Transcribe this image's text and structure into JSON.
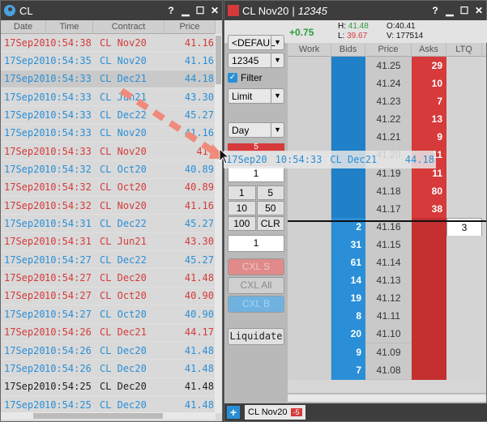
{
  "ts": {
    "title": "CL",
    "headers": [
      "Date",
      "Time",
      "Contract",
      "Price"
    ],
    "rows": [
      {
        "date": "17Sep20",
        "time": "10:54:38",
        "contract": "CL Nov20",
        "price": "41.16",
        "color": "red"
      },
      {
        "date": "17Sep20",
        "time": "10:54:35",
        "contract": "CL Nov20",
        "price": "41.16",
        "color": "blue"
      },
      {
        "date": "17Sep20",
        "time": "10:54:33",
        "contract": "CL Dec21",
        "price": "44.18",
        "color": "blue"
      },
      {
        "date": "17Sep20",
        "time": "10:54:33",
        "contract": "CL Jun21",
        "price": "43.30",
        "color": "blue"
      },
      {
        "date": "17Sep20",
        "time": "10:54:33",
        "contract": "CL Dec22",
        "price": "45.27",
        "color": "blue"
      },
      {
        "date": "17Sep20",
        "time": "10:54:33",
        "contract": "CL Nov20",
        "price": "41.16",
        "color": "blue"
      },
      {
        "date": "17Sep20",
        "time": "10:54:33",
        "contract": "CL Nov20",
        "price": "41.",
        "color": "red"
      },
      {
        "date": "17Sep20",
        "time": "10:54:32",
        "contract": "CL Oct20",
        "price": "40.89",
        "color": "blue"
      },
      {
        "date": "17Sep20",
        "time": "10:54:32",
        "contract": "CL Oct20",
        "price": "40.89",
        "color": "red"
      },
      {
        "date": "17Sep20",
        "time": "10:54:32",
        "contract": "CL Nov20",
        "price": "41.16",
        "color": "red"
      },
      {
        "date": "17Sep20",
        "time": "10:54:31",
        "contract": "CL Dec22",
        "price": "45.27",
        "color": "blue"
      },
      {
        "date": "17Sep20",
        "time": "10:54:31",
        "contract": "CL Jun21",
        "price": "43.30",
        "color": "red"
      },
      {
        "date": "17Sep20",
        "time": "10:54:27",
        "contract": "CL Dec22",
        "price": "45.27",
        "color": "blue"
      },
      {
        "date": "17Sep20",
        "time": "10:54:27",
        "contract": "CL Dec20",
        "price": "41.48",
        "color": "red"
      },
      {
        "date": "17Sep20",
        "time": "10:54:27",
        "contract": "CL Oct20",
        "price": "40.90",
        "color": "red"
      },
      {
        "date": "17Sep20",
        "time": "10:54:27",
        "contract": "CL Oct20",
        "price": "40.90",
        "color": "blue"
      },
      {
        "date": "17Sep20",
        "time": "10:54:26",
        "contract": "CL Dec21",
        "price": "44.17",
        "color": "red"
      },
      {
        "date": "17Sep20",
        "time": "10:54:26",
        "contract": "CL Dec20",
        "price": "41.48",
        "color": "blue"
      },
      {
        "date": "17Sep20",
        "time": "10:54:26",
        "contract": "CL Dec20",
        "price": "41.48",
        "color": "blue"
      },
      {
        "date": "17Sep20",
        "time": "10:54:25",
        "contract": "CL Dec20",
        "price": "41.48",
        "color": "black"
      },
      {
        "date": "17Sep20",
        "time": "10:54:25",
        "contract": "CL Dec20",
        "price": "41.48",
        "color": "blue"
      }
    ]
  },
  "ladder": {
    "title": "CL Nov20",
    "account": "12345",
    "change": "+0.75",
    "high_label": "H:",
    "high": "41.48",
    "low_label": "L:",
    "low": "39.67",
    "open_label": "O:",
    "open": "40.41",
    "vol_label": "V:",
    "vol": "177514",
    "account_select": "<DEFAUL",
    "account_select2": "12345",
    "filter_label": "Filter",
    "order_type": "Limit",
    "tif": "Day",
    "sell_badge": "5",
    "qty_top": "1",
    "numpad": [
      "1",
      "5",
      "10",
      "50",
      "100",
      "CLR"
    ],
    "qty_bottom": "1",
    "cxl_s": "CXL S",
    "cxl_all": "CXL All",
    "cxl_b": "CXL B",
    "liquidate": "Liquidate",
    "headers": [
      "Work",
      "Bids",
      "Price",
      "Asks",
      "LTQ"
    ],
    "rows": [
      {
        "bid": "",
        "price": "41.25",
        "ask": "29",
        "ltq": ""
      },
      {
        "bid": "",
        "price": "41.24",
        "ask": "10",
        "ltq": ""
      },
      {
        "bid": "",
        "price": "41.23",
        "ask": "7",
        "ltq": ""
      },
      {
        "bid": "",
        "price": "41.22",
        "ask": "13",
        "ltq": ""
      },
      {
        "bid": "",
        "price": "41.21",
        "ask": "9",
        "ltq": ""
      },
      {
        "bid": "",
        "price": "41.20",
        "ask": "11",
        "ltq": ""
      },
      {
        "bid": "",
        "price": "41.19",
        "ask": "11",
        "ltq": ""
      },
      {
        "bid": "",
        "price": "41.18",
        "ask": "80",
        "ltq": ""
      },
      {
        "bid": "",
        "price": "41.17",
        "ask": "38",
        "ltq": ""
      },
      {
        "bid": "2",
        "price": "41.16",
        "ask": "",
        "ltq": "3"
      },
      {
        "bid": "31",
        "price": "41.15",
        "ask": "",
        "ltq": ""
      },
      {
        "bid": "61",
        "price": "41.14",
        "ask": "",
        "ltq": ""
      },
      {
        "bid": "14",
        "price": "41.13",
        "ask": "",
        "ltq": ""
      },
      {
        "bid": "19",
        "price": "41.12",
        "ask": "",
        "ltq": ""
      },
      {
        "bid": "8",
        "price": "41.11",
        "ask": "",
        "ltq": ""
      },
      {
        "bid": "20",
        "price": "41.10",
        "ask": "",
        "ltq": ""
      },
      {
        "bid": "9",
        "price": "41.09",
        "ask": "",
        "ltq": ""
      },
      {
        "bid": "7",
        "price": "41.08",
        "ask": "",
        "ltq": ""
      }
    ],
    "tab_label": "CL Nov20",
    "tab_badge": "-5"
  },
  "drag": {
    "date": "17Sep20",
    "time": "10:54:33",
    "contract": "CL Dec21",
    "price": "44.18"
  }
}
